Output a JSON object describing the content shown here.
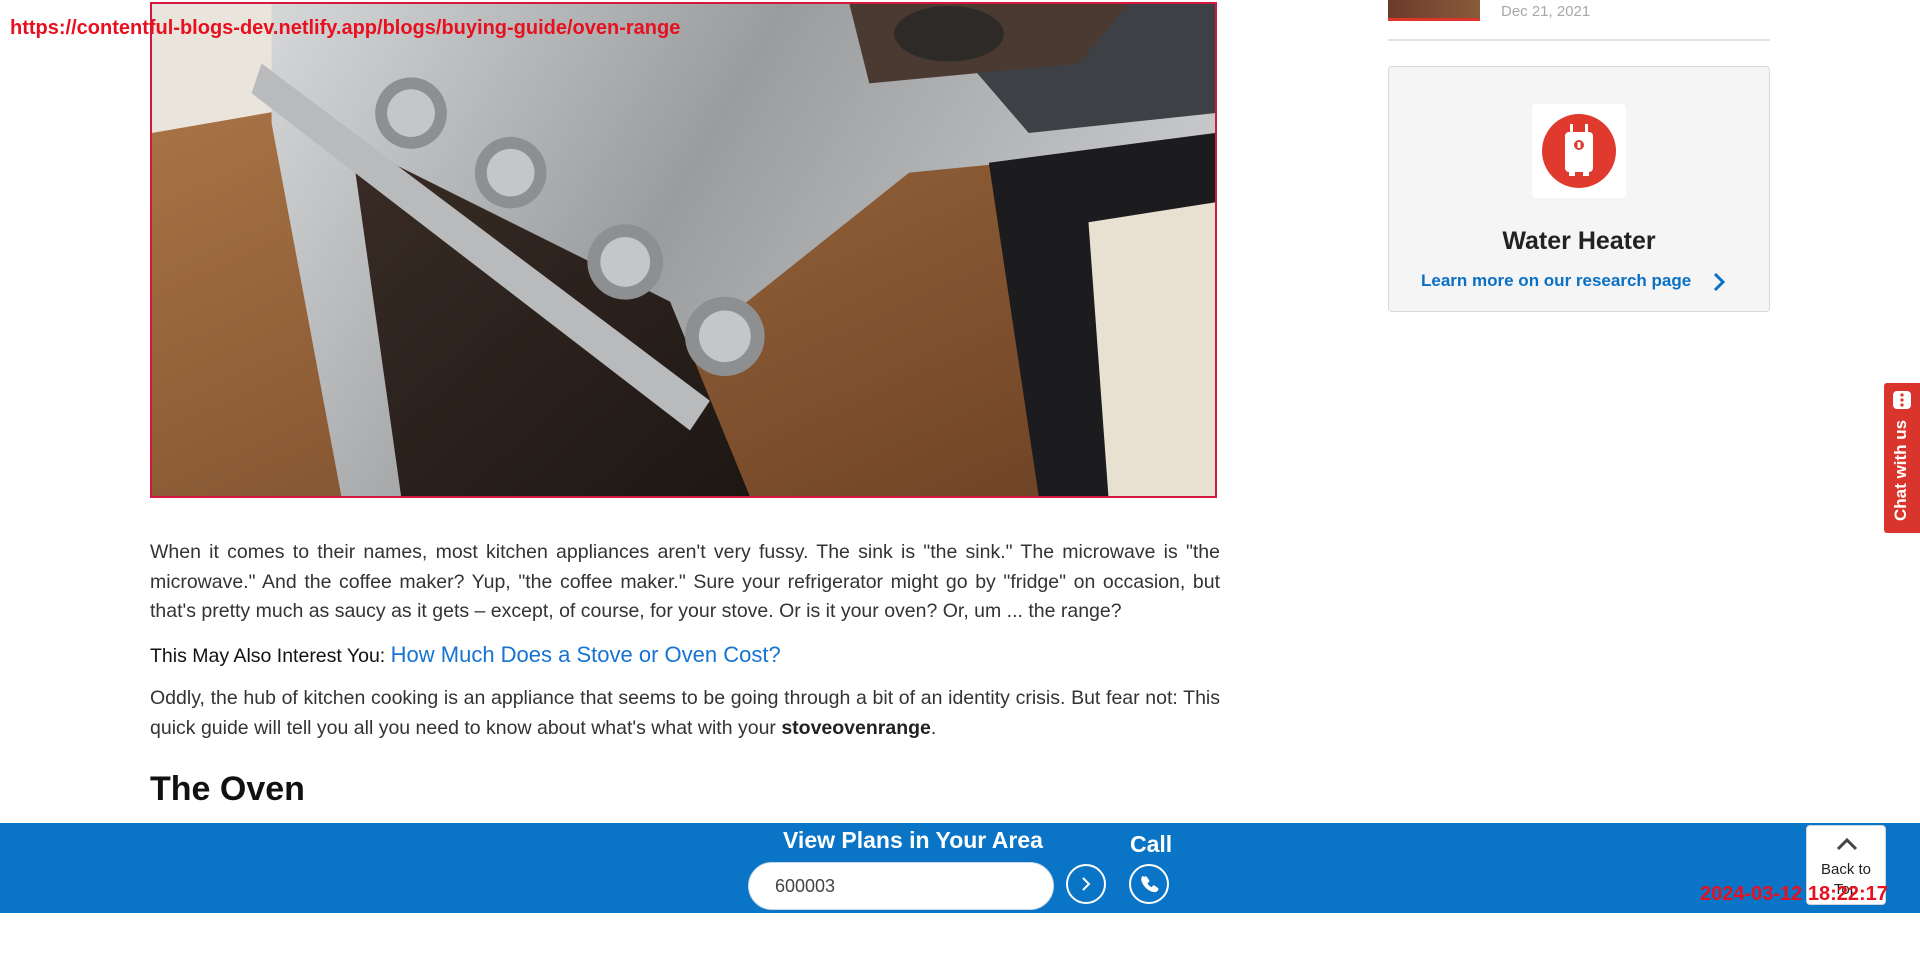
{
  "browser": {
    "url": "https://contentful-blogs-dev.netlify.app/blogs/buying-guide/oven-range",
    "timestamp": "2024-03-12 18:22:17"
  },
  "article": {
    "paragraph1": "When it comes to their names, most kitchen appliances aren't very fussy. The sink is \"the sink.\" The microwave is \"the microwave.\" And the coffee maker? Yup, \"the coffee maker.\" Sure your refrigerator might go by \"fridge\" on occasion, but that's pretty much as saucy as it gets – except, of course, for your stove. Or is it your oven? Or, um ... the range?",
    "interest_label": "This May Also Interest You:",
    "interest_link": "How Much Does a Stove or Oven Cost?",
    "paragraph2_prefix": "Oddly, the hub of kitchen cooking is an appliance that seems to be going through a bit of an identity crisis. But fear not: This quick guide will tell you all you need to know about what's what with your",
    "paragraph2_bold": "stoveovenrange",
    "paragraph2_suffix": ".",
    "section_heading": "The Oven"
  },
  "sidebar": {
    "prev_item_date": "Dec 21, 2021",
    "card": {
      "icon": "water-heater-icon",
      "title": "Water Heater",
      "link": "Learn more on our research page"
    }
  },
  "chat": {
    "label": "Chat with us"
  },
  "bottom_bar": {
    "title": "View Plans in Your Area",
    "zip_value": "600003",
    "call_label": "Call"
  },
  "back_to_top": {
    "label": "Back to Top"
  },
  "colors": {
    "brand_blue": "#0a74c6",
    "link_blue": "#1673d2",
    "accent_red": "#d9352c"
  }
}
